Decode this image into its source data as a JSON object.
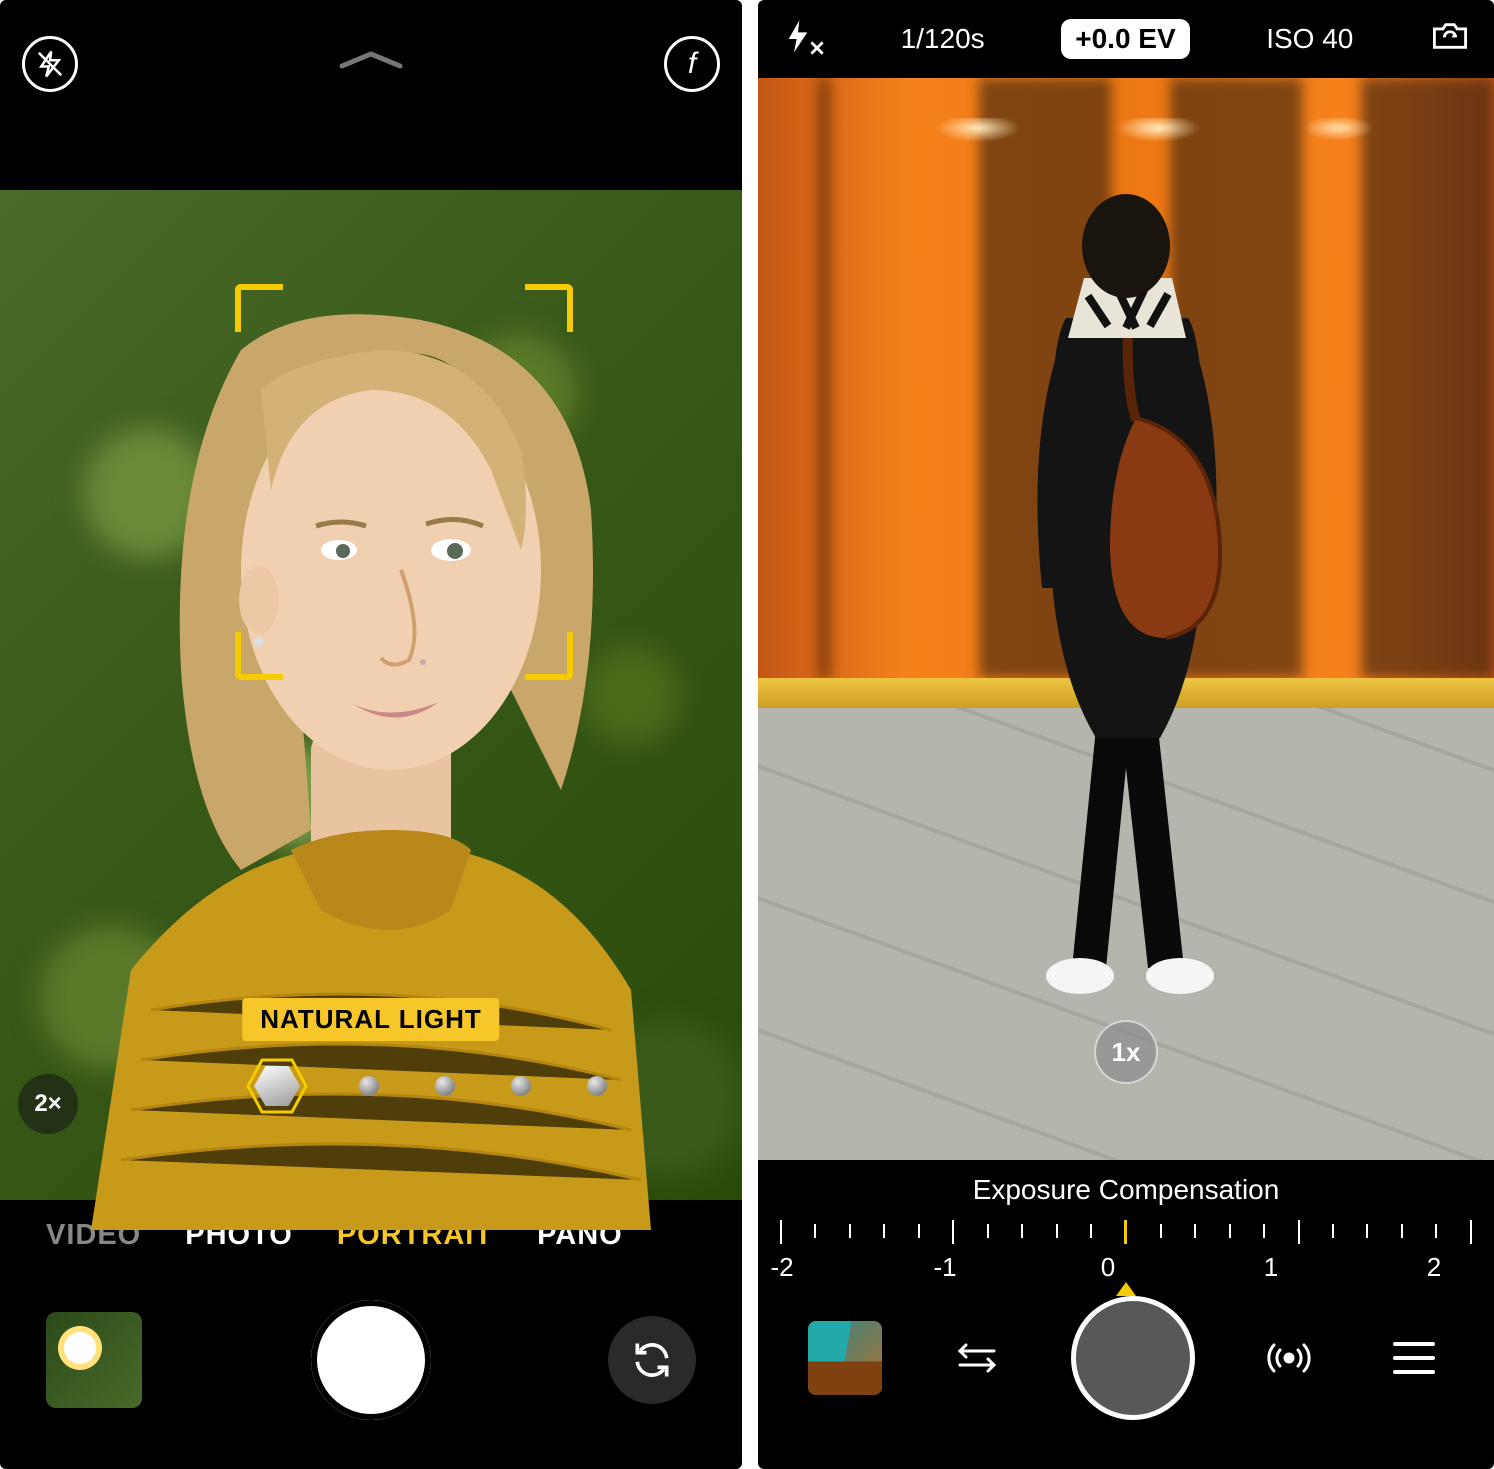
{
  "left": {
    "zoom": "2×",
    "lighting_label": "NATURAL LIGHT",
    "modes": {
      "video": "VIDEO",
      "photo": "PHOTO",
      "portrait": "PORTRAIT",
      "pano": "PANO",
      "active": "PORTRAIT"
    }
  },
  "right": {
    "top": {
      "shutter_speed": "1/120s",
      "ev": "+0.0 EV",
      "iso": "ISO 40"
    },
    "zoom": "1x",
    "exposure_label": "Exposure Compensation",
    "scale_values": [
      "-2",
      "-1",
      "0",
      "1",
      "2"
    ],
    "scale_current": 0
  }
}
